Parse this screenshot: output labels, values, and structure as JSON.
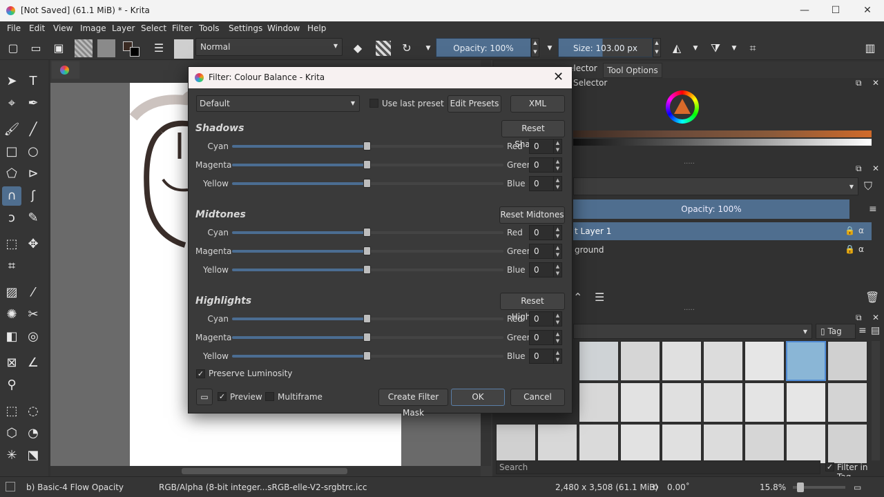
{
  "window": {
    "title": "[Not Saved]  (61.1 MiB) * - Krita"
  },
  "menubar": [
    "File",
    "Edit",
    "View",
    "Image",
    "Layer",
    "Select",
    "Filter",
    "Tools",
    "Settings",
    "Window",
    "Help"
  ],
  "toolbar": {
    "blend_mode": "Normal",
    "opacity": "Opacity: 100%",
    "size": "Size: 103.00 px"
  },
  "right_dock": {
    "tabs": [
      "Advanced Color Selector",
      "Tool Options"
    ],
    "tab_partial": "elector",
    "color_selector_title": "Selector",
    "layers_opacity": "Opacity:  100%",
    "layers": [
      "t Layer 1",
      "ground"
    ],
    "brush_tag": "Tag",
    "brush_search_placeholder": "Search",
    "filter_in_tag": "Filter in Tag"
  },
  "dialog": {
    "title": "Filter: Colour Balance - Krita",
    "preset": "Default",
    "use_last_preset": "Use last preset",
    "edit_presets": "Edit Presets",
    "xml": "XML",
    "sections": [
      {
        "title": "Shadows",
        "reset": "Reset Shadows",
        "rows": [
          {
            "left": "Cyan",
            "right": "Red",
            "value": "0"
          },
          {
            "left": "Magenta",
            "right": "Green",
            "value": "0"
          },
          {
            "left": "Yellow",
            "right": "Blue",
            "value": "0"
          }
        ]
      },
      {
        "title": "Midtones",
        "reset": "Reset Midtones",
        "rows": [
          {
            "left": "Cyan",
            "right": "Red",
            "value": "0"
          },
          {
            "left": "Magenta",
            "right": "Green",
            "value": "0"
          },
          {
            "left": "Yellow",
            "right": "Blue",
            "value": "0"
          }
        ]
      },
      {
        "title": "Highlights",
        "reset": "Reset Highlights",
        "rows": [
          {
            "left": "Cyan",
            "right": "Red",
            "value": "0"
          },
          {
            "left": "Magenta",
            "right": "Green",
            "value": "0"
          },
          {
            "left": "Yellow",
            "right": "Blue",
            "value": "0"
          }
        ]
      }
    ],
    "preserve_luminosity": "Preserve Luminosity",
    "preview": "Preview",
    "multiframe": "Multiframe",
    "create_filter_mask": "Create Filter Mask",
    "ok": "OK",
    "cancel": "Cancel"
  },
  "statusbar": {
    "brush": "b) Basic-4 Flow Opacity",
    "colorspace": "RGB/Alpha (8-bit integer...sRGB-elle-V2-srgbtrc.icc",
    "dims": "2,480 x 3,508 (61.1 MiB)",
    "rotation": "0.00˚",
    "zoom": "15.8%"
  },
  "colors": {
    "accent": "#4f6e8f",
    "dialog_bg": "#3a3a3a",
    "titlebar": "#f3f3f3"
  }
}
